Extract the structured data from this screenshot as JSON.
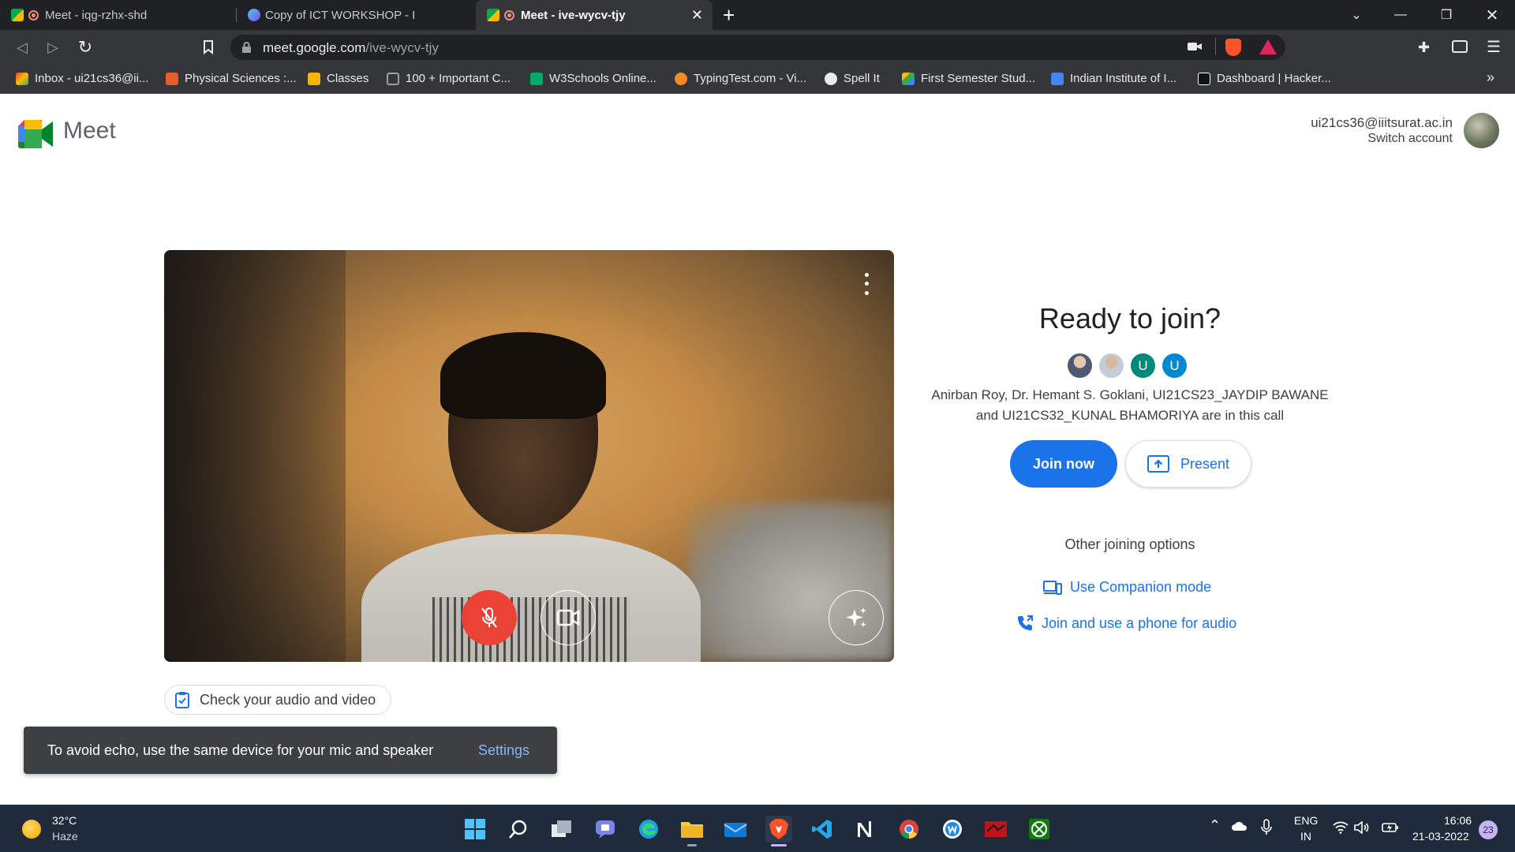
{
  "browser": {
    "tabs": [
      {
        "title": "Meet - iqg-rzhx-shd"
      },
      {
        "title": "Copy of ICT WORKSHOP - I"
      },
      {
        "title": "Meet - ive-wycv-tjy"
      }
    ],
    "new_tab": "+",
    "url_host": "meet.google.com",
    "url_path": "/ive-wycv-tjy",
    "bookmarks": [
      {
        "label": "Inbox - ui21cs36@ii...",
        "icon": "gmail-icon"
      },
      {
        "label": "Physical Sciences :...",
        "icon": "bookmark-site-icon"
      },
      {
        "label": "Classes",
        "icon": "classroom-icon"
      },
      {
        "label": "100 + Important C...",
        "icon": "bookmark-folder-icon"
      },
      {
        "label": "W3Schools Online...",
        "icon": "w3schools-icon"
      },
      {
        "label": "TypingTest.com - Vi...",
        "icon": "typingtest-icon"
      },
      {
        "label": "Spell It",
        "icon": "spellit-icon"
      },
      {
        "label": "First Semester Stud...",
        "icon": "drive-icon"
      },
      {
        "label": "Indian Institute of I...",
        "icon": "calendar-icon"
      },
      {
        "label": "Dashboard | Hacker...",
        "icon": "hackerrank-icon"
      }
    ],
    "bookmarks_more": "»"
  },
  "meet": {
    "brand": "Meet",
    "account_email": "ui21cs36@iiitsurat.ac.in",
    "switch_account": "Switch account",
    "check_audio_video": "Check your audio and video",
    "toast_text": "To avoid echo, use the same device for your mic and speaker",
    "toast_settings": "Settings",
    "ready_title": "Ready to join?",
    "participants": [
      {
        "initial": "",
        "color": "#7a8a9a"
      },
      {
        "initial": "",
        "color": "#8f9aa5"
      },
      {
        "initial": "U",
        "color": "#00897b"
      },
      {
        "initial": "U",
        "color": "#0288d1"
      }
    ],
    "in_call_line1": "Anirban Roy, Dr. Hemant S. Goklani, UI21CS23_JAYDIP BAWANE",
    "in_call_line2": "and UI21CS32_KUNAL BHAMORIYA are in this call",
    "join_now": "Join now",
    "present": "Present",
    "other_options": "Other joining options",
    "companion_mode": "Use Companion mode",
    "phone_audio": "Join and use a phone for audio",
    "accent_color": "#1a73e8",
    "mic_off_color": "#ea4335"
  },
  "taskbar": {
    "temperature": "32°C",
    "weather": "Haze",
    "lang_line1": "ENG",
    "lang_line2": "IN",
    "time": "16:06",
    "date": "21-03-2022",
    "notifications": "23"
  }
}
